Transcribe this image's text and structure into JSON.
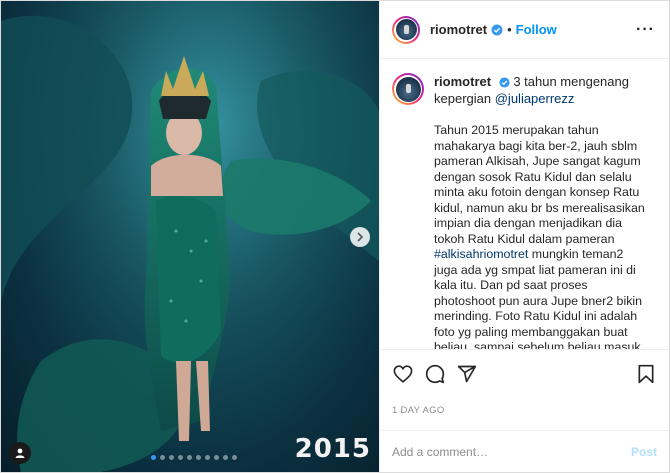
{
  "post": {
    "username": "riomotret",
    "separator": "•",
    "follow_label": "Follow",
    "more_icon": "more-options-icon",
    "caption_title": "3 tahun mengenang kepergian",
    "caption_mention": "@juliaperrezz",
    "caption_part1": "Tahun 2015 merupakan tahun mahakarya bagi kita ber-2, jauh sblm pameran Alkisah, Jupe sangat kagum dengan sosok Ratu Kidul dan selalu minta aku fotoin dengan konsep Ratu kidul, namun aku br bs merealisasikan impian dia dengan menjadikan dia tokoh Ratu Kidul dalam pameran",
    "caption_hashtag": "#alkisahriomotret",
    "caption_part2": " mungkin teman2 juga ada yg smpat liat pameran ini di kala itu. Dan pd saat proses photoshoot pun aura Jupe bner2 bikin merinding. Foto Ratu Kidul ini adalah foto yg paling membanggakan buat beliau, sampai sebelum beliau masuk RS beliau minta ft itu di cetak ukuran",
    "timestamp": "1 DAY AGO",
    "comment_placeholder": "Add a comment…",
    "post_label": "Post"
  },
  "media": {
    "overlay_text": "2015",
    "carousel_count": 10,
    "carousel_active": 1
  },
  "colors": {
    "accent": "#0095f6",
    "verified": "#3897f0"
  }
}
